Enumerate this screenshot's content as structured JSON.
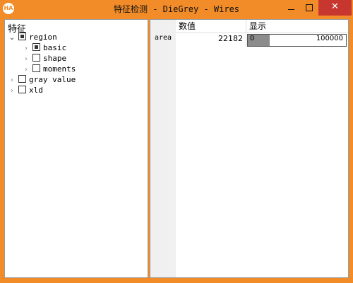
{
  "window": {
    "app_icon_text": "HA",
    "title": "特征检测 - DieGrey - Wires",
    "buttons": {
      "minimize": "minimize",
      "maximize": "maximize",
      "close": "✕"
    }
  },
  "feature_tree": {
    "title": "特征",
    "items": [
      {
        "label": "region",
        "level": 0,
        "expanded": true,
        "check": "partial"
      },
      {
        "label": "basic",
        "level": 1,
        "expanded": false,
        "check": "partial"
      },
      {
        "label": "shape",
        "level": 1,
        "expanded": false,
        "check": "none"
      },
      {
        "label": "moments",
        "level": 1,
        "expanded": false,
        "check": "none"
      },
      {
        "label": "gray value",
        "level": 0,
        "expanded": false,
        "check": "none"
      },
      {
        "label": "xld",
        "level": 0,
        "expanded": false,
        "check": "none"
      }
    ]
  },
  "results_grid": {
    "columns": [
      "数值",
      "显示"
    ],
    "rows": [
      {
        "name": "area",
        "value": "22182",
        "bar_min": "0",
        "bar_max": "100000",
        "bar_fraction": 0.22182
      }
    ]
  },
  "colors": {
    "frame": "#f28c28",
    "close_button": "#c7372f",
    "bar_fill": "#8c8c8c"
  }
}
